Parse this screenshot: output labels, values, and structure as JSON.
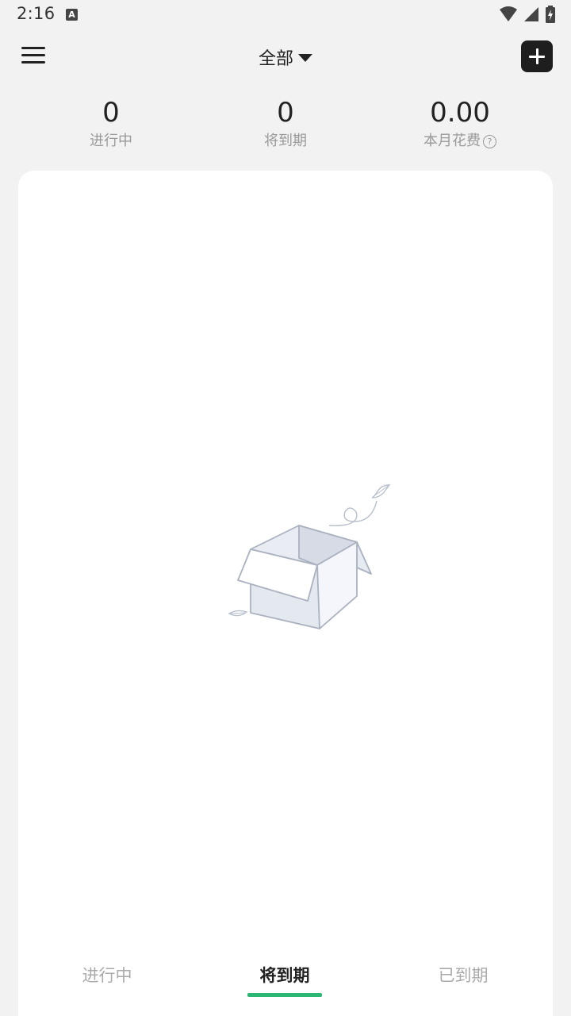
{
  "status_bar": {
    "time": "2:16",
    "notification_glyph": "A"
  },
  "header": {
    "filter_label": "全部"
  },
  "stats": [
    {
      "value": "0",
      "label": "进行中"
    },
    {
      "value": "0",
      "label": "将到期"
    },
    {
      "value": "0.00",
      "label": "本月花费"
    }
  ],
  "tabs": [
    {
      "label": "进行中"
    },
    {
      "label": "将到期"
    },
    {
      "label": "已到期"
    }
  ],
  "active_tab": "将到期",
  "colors": {
    "accent": "#2bb673",
    "background": "#f2f2f2",
    "card": "#ffffff"
  }
}
